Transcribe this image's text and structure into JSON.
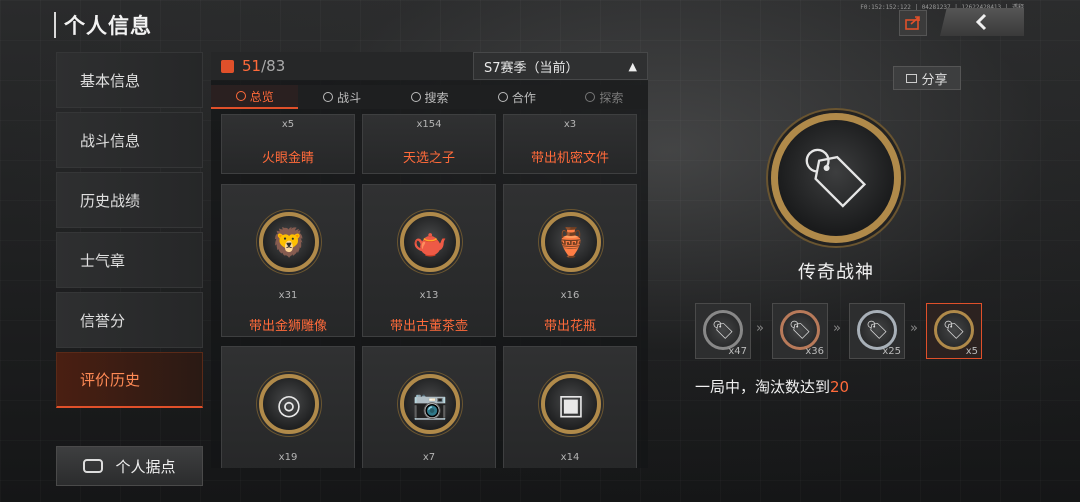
{
  "header": {
    "title": "个人信息",
    "top_info": "F0:152:152:122 | 04281237 | 12622428413 | 透释"
  },
  "colors": {
    "accent": "#e0502a",
    "highlight": "#ff6a3a",
    "gold_ring": "#b08a4a"
  },
  "icons": {
    "share_top": "share-icon",
    "back": "chevron-left-icon",
    "medal": "medal-icon",
    "base": "base-icon"
  },
  "sidebar": {
    "items": [
      {
        "label": "基本信息",
        "active": false
      },
      {
        "label": "战斗信息",
        "active": false
      },
      {
        "label": "历史战绩",
        "active": false
      },
      {
        "label": "士气章",
        "active": false
      },
      {
        "label": "信誉分",
        "active": false
      },
      {
        "label": "评价历史",
        "active": true
      }
    ],
    "base_button": "个人据点"
  },
  "panel": {
    "count_current": "51",
    "count_total": "/83",
    "season": "S7赛季（当前）",
    "caret": "▲",
    "tabs": [
      {
        "label": "总览",
        "active": true
      },
      {
        "label": "战斗",
        "active": false
      },
      {
        "label": "搜索",
        "active": false
      },
      {
        "label": "合作",
        "active": false
      },
      {
        "label": "探索",
        "active": false
      }
    ],
    "cards_top": [
      {
        "count": "x5",
        "name": "火眼金睛"
      },
      {
        "count": "x154",
        "name": "天选之子"
      },
      {
        "count": "x3",
        "name": "带出机密文件"
      }
    ],
    "cards_mid": [
      {
        "count": "x31",
        "name": "带出金狮雕像",
        "glyph": "🦁"
      },
      {
        "count": "x13",
        "name": "带出古董茶壶",
        "glyph": "🫖"
      },
      {
        "count": "x16",
        "name": "带出花瓶",
        "glyph": "🏺"
      }
    ],
    "cards_bottom": [
      {
        "count": "x19",
        "glyph": "◎"
      },
      {
        "count": "x7",
        "glyph": "📷"
      },
      {
        "count": "x14",
        "glyph": "▣"
      }
    ]
  },
  "detail": {
    "share_label": "分享",
    "name": "传奇战神",
    "featured_glyph": "🏷",
    "tiers": [
      {
        "count": "x47",
        "active": false
      },
      {
        "count": "x36",
        "active": false
      },
      {
        "count": "x25",
        "active": false
      },
      {
        "count": "x5",
        "active": true
      }
    ],
    "tier_arrow": "»",
    "desc_prefix": "一局中，淘汰数达到",
    "desc_value": "20"
  }
}
